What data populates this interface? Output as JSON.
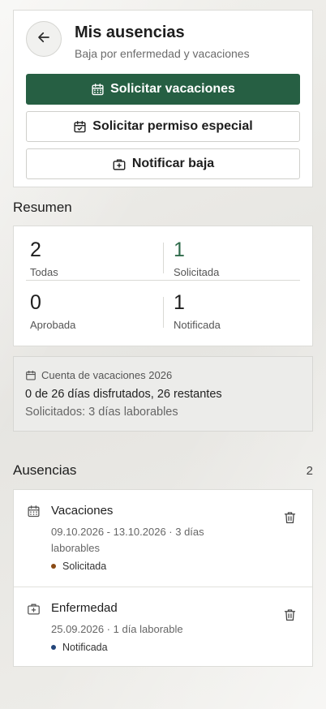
{
  "header": {
    "title": "Mis ausencias",
    "subtitle": "Baja por enfermedad y vacaciones"
  },
  "actions": {
    "request_vacation": "Solicitar vacaciones",
    "request_special_leave": "Solicitar permiso especial",
    "notify_sick_leave": "Notificar baja"
  },
  "summary": {
    "title": "Resumen",
    "cells": [
      {
        "value": "2",
        "label": "Todas"
      },
      {
        "value": "1",
        "label": "Solicitada"
      },
      {
        "value": "0",
        "label": "Aprobada"
      },
      {
        "value": "1",
        "label": "Notificada"
      }
    ]
  },
  "vacation_account": {
    "title": "Cuenta de vacaciones 2026",
    "line1": "0 de 26 días disfrutados, 26 restantes",
    "line2": "Solicitados: 3 días laborables"
  },
  "absences": {
    "title": "Ausencias",
    "count": "2",
    "items": [
      {
        "type": "Vacaciones",
        "dates": "09.10.2026 - 13.10.2026 · 3 días laborables",
        "status": "Solicitada",
        "status_color": "#8a4a14",
        "icon": "calendar-icon"
      },
      {
        "type": "Enfermedad",
        "dates": "25.09.2026 · 1 día laborable",
        "status": "Notificada",
        "status_color": "#23457a",
        "icon": "medical-kit-icon"
      }
    ]
  },
  "colors": {
    "primary": "#265f43",
    "requested_count": "#2f6b4b"
  }
}
